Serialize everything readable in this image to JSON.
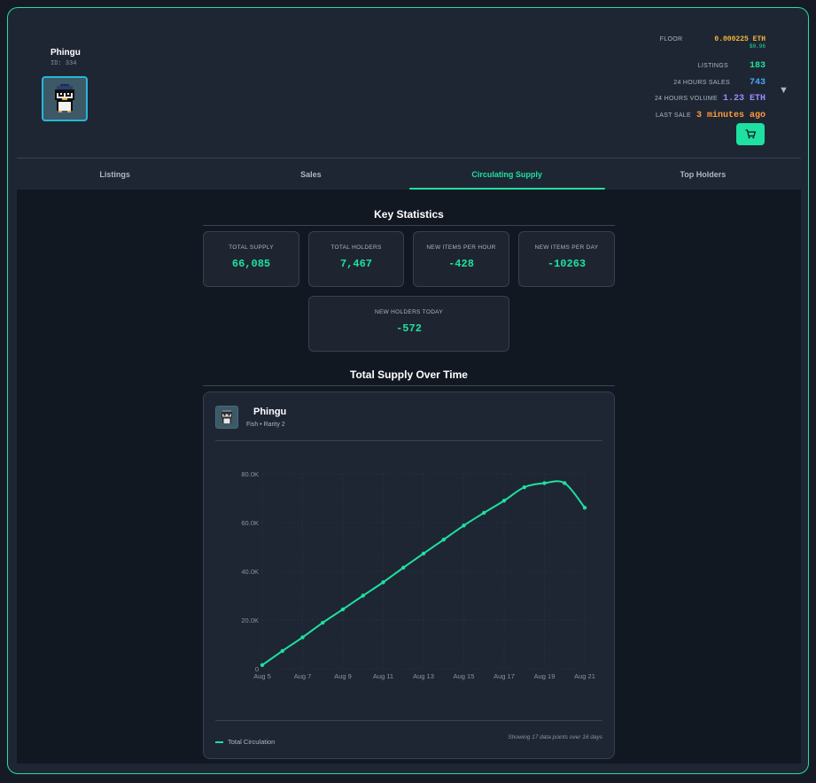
{
  "nft": {
    "name": "Phingu",
    "id": "ID: 334",
    "thumb_icon": "penguin-pixel-icon"
  },
  "market": {
    "floor_label": "FLOOR",
    "floor_eth": "0.000225 ETH",
    "floor_usd": "$0.96",
    "listings_label": "LISTINGS",
    "listings": "183",
    "sales_label": "24 HOURS SALES",
    "sales": "743",
    "volume_label": "24 HOURS VOLUME",
    "volume": "1.23 ETH",
    "last_sale_label": "LAST SALE",
    "last_sale": "3 minutes ago",
    "dropdown_icon": "chevron-down-icon",
    "cart_icon": "cart-icon",
    "colors": {
      "floor": "#f5b938",
      "listings": "#1ee0a0",
      "sales": "#4aa8ff",
      "volume": "#9b8cff",
      "last_sale": "#ff9a3c"
    }
  },
  "tabs": [
    {
      "label": "Listings",
      "active": false
    },
    {
      "label": "Sales",
      "active": false
    },
    {
      "label": "Circulating Supply",
      "active": true
    },
    {
      "label": "Top Holders",
      "active": false
    }
  ],
  "key_stats": {
    "title": "Key Statistics",
    "cards": [
      {
        "label": "TOTAL SUPPLY",
        "value": "66,085"
      },
      {
        "label": "TOTAL HOLDERS",
        "value": "7,467"
      },
      {
        "label": "NEW ITEMS PER HOUR",
        "value": "-428"
      },
      {
        "label": "NEW ITEMS PER DAY",
        "value": "-10263"
      },
      {
        "label": "NEW HOLDERS TODAY",
        "value": "-572"
      }
    ]
  },
  "supply_chart": {
    "title": "Total Supply Over Time",
    "item_name": "Phingu",
    "item_sub": "Fish • Rarity 2",
    "legend": "Total Circulation",
    "footnote": "Showing 17 data points over 16 days"
  },
  "chart_data": {
    "type": "line",
    "x": [
      "Aug 5",
      "Aug 6",
      "Aug 7",
      "Aug 8",
      "Aug 9",
      "Aug 10",
      "Aug 11",
      "Aug 12",
      "Aug 13",
      "Aug 14",
      "Aug 15",
      "Aug 16",
      "Aug 17",
      "Aug 18",
      "Aug 19",
      "Aug 20",
      "Aug 21"
    ],
    "xticks": [
      "Aug 5",
      "Aug 7",
      "Aug 9",
      "Aug 11",
      "Aug 13",
      "Aug 15",
      "Aug 17",
      "Aug 19",
      "Aug 21"
    ],
    "series": [
      {
        "name": "Total Circulation",
        "color": "#1ee0a0",
        "values": [
          1500,
          7300,
          12900,
          18900,
          24400,
          30000,
          35500,
          41500,
          47300,
          53000,
          58800,
          64000,
          69000,
          74500,
          76200,
          76200,
          66100
        ]
      }
    ],
    "ylim": [
      0,
      80000
    ],
    "yticks": [
      {
        "value": 0,
        "label": "0"
      },
      {
        "value": 20000,
        "label": "20.0K"
      },
      {
        "value": 40000,
        "label": "40.0K"
      },
      {
        "value": 60000,
        "label": "60.0K"
      },
      {
        "value": 80000,
        "label": "80.0K"
      }
    ],
    "grid": true,
    "legend_position": "bottom-left"
  }
}
